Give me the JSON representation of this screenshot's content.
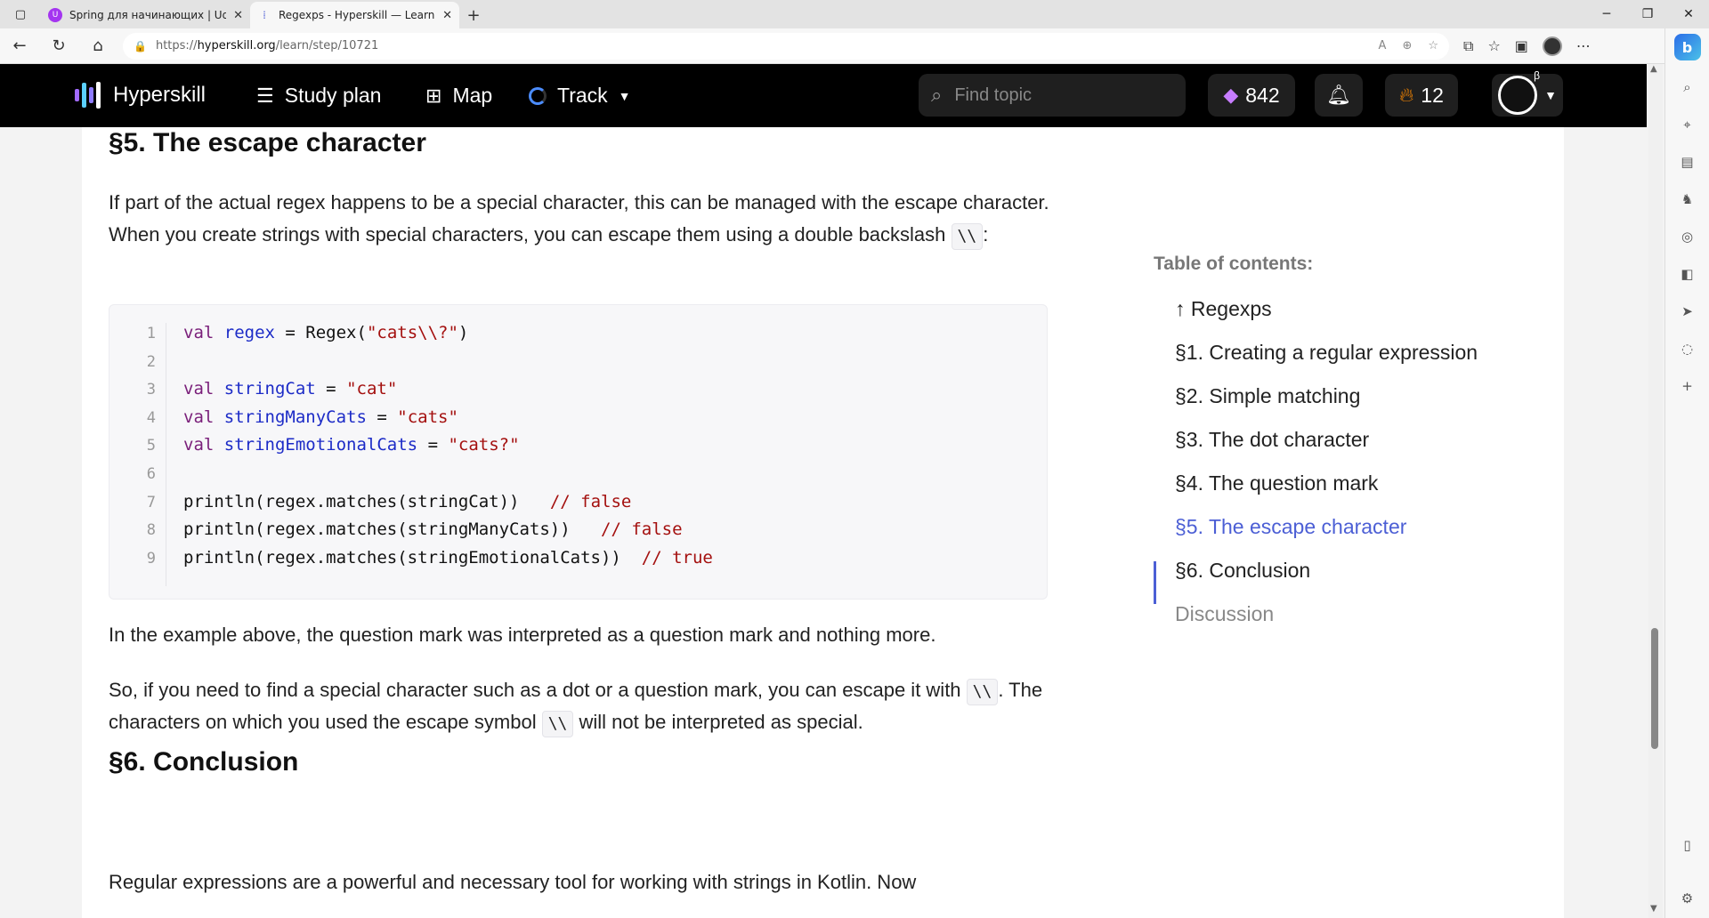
{
  "browser": {
    "tabs": [
      {
        "title": "Spring для начинающих | Udem",
        "favicon_color": "#a435f0",
        "active": false
      },
      {
        "title": "Regexps - Hyperskill — Learn pro",
        "favicon_color": "#5a6ad8",
        "active": true
      }
    ],
    "url": {
      "scheme": "https://",
      "host": "hyperskill.org",
      "path": "/learn/step/10721"
    }
  },
  "header": {
    "logo_text": "Hyperskill",
    "nav": {
      "study_plan": "Study plan",
      "map": "Map",
      "track": "Track"
    },
    "search_placeholder": "Find topic",
    "gems": "842",
    "streak": "12",
    "beta_badge": "β"
  },
  "article": {
    "section5": {
      "heading": "§5. The escape character",
      "intro_1": "If part of the actual regex happens to be a special character, this can be managed with the escape character. When you create strings with special characters, you can escape them using a double backslash ",
      "intro_code": "\\\\",
      "intro_end": ":",
      "after_code": "In the example above, the question mark was interpreted as a question mark and nothing more.",
      "para2_a": "So, if you need to find a special character such as a dot or a question mark, you can escape it with ",
      "para2_code1": "\\\\",
      "para2_b": ". The characters on which you used the escape symbol ",
      "para2_code2": "\\\\",
      "para2_c": " will not be interpreted as special."
    },
    "code_lines": [
      {
        "n": "1",
        "kw": "val",
        "var": "regex",
        "rest": " = Regex(",
        "str": "\"cats\\\\?\"",
        "tail": ")",
        "comment": ""
      },
      {
        "n": "2",
        "kw": "",
        "var": "",
        "rest": "",
        "str": "",
        "tail": "",
        "comment": ""
      },
      {
        "n": "3",
        "kw": "val",
        "var": "stringCat",
        "rest": " = ",
        "str": "\"cat\"",
        "tail": "",
        "comment": ""
      },
      {
        "n": "4",
        "kw": "val",
        "var": "stringManyCats",
        "rest": " = ",
        "str": "\"cats\"",
        "tail": "",
        "comment": ""
      },
      {
        "n": "5",
        "kw": "val",
        "var": "stringEmotionalCats",
        "rest": " = ",
        "str": "\"cats?\"",
        "tail": "",
        "comment": ""
      },
      {
        "n": "6",
        "kw": "",
        "var": "",
        "rest": "",
        "str": "",
        "tail": "",
        "comment": ""
      },
      {
        "n": "7",
        "kw": "",
        "var": "",
        "rest": "println(regex.matches(stringCat))",
        "str": "",
        "tail": "",
        "comment": "   // false"
      },
      {
        "n": "8",
        "kw": "",
        "var": "",
        "rest": "println(regex.matches(stringManyCats))",
        "str": "",
        "tail": "",
        "comment": "   // false"
      },
      {
        "n": "9",
        "kw": "",
        "var": "",
        "rest": "println(regex.matches(stringEmotionalCats))",
        "str": "",
        "tail": "",
        "comment": "  // true"
      }
    ],
    "section6": {
      "heading": "§6. Conclusion",
      "para": "Regular expressions are a powerful and necessary tool for working with strings in Kotlin. Now"
    }
  },
  "toc": {
    "title": "Table of contents:",
    "items": [
      {
        "label": "↑ Regexps",
        "state": "normal"
      },
      {
        "label": "§1. Creating a regular expression",
        "state": "normal"
      },
      {
        "label": "§2. Simple matching",
        "state": "normal"
      },
      {
        "label": "§3. The dot character",
        "state": "normal"
      },
      {
        "label": "§4. The question mark",
        "state": "normal"
      },
      {
        "label": "§5. The escape character",
        "state": "active"
      },
      {
        "label": "§6. Conclusion",
        "state": "normal"
      },
      {
        "label": "Discussion",
        "state": "muted"
      }
    ]
  },
  "colors": {
    "accent": "#4c5fd5",
    "header_bg": "#000000",
    "gem": "#c77dff",
    "fire": "#ff8a00"
  }
}
